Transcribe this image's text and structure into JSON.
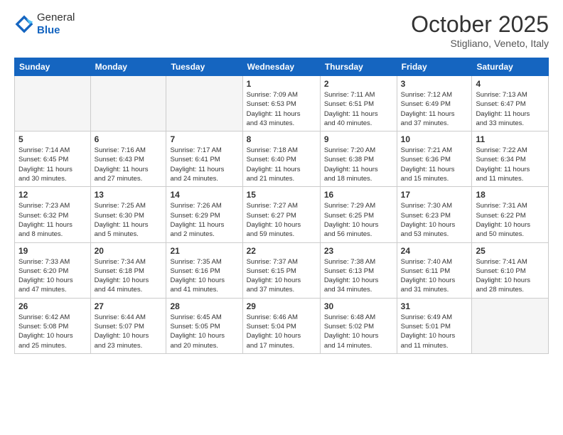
{
  "header": {
    "logo_general": "General",
    "logo_blue": "Blue",
    "month_title": "October 2025",
    "location": "Stigliano, Veneto, Italy"
  },
  "weekdays": [
    "Sunday",
    "Monday",
    "Tuesday",
    "Wednesday",
    "Thursday",
    "Friday",
    "Saturday"
  ],
  "weeks": [
    [
      {
        "day": "",
        "info": ""
      },
      {
        "day": "",
        "info": ""
      },
      {
        "day": "",
        "info": ""
      },
      {
        "day": "1",
        "info": "Sunrise: 7:09 AM\nSunset: 6:53 PM\nDaylight: 11 hours\nand 43 minutes."
      },
      {
        "day": "2",
        "info": "Sunrise: 7:11 AM\nSunset: 6:51 PM\nDaylight: 11 hours\nand 40 minutes."
      },
      {
        "day": "3",
        "info": "Sunrise: 7:12 AM\nSunset: 6:49 PM\nDaylight: 11 hours\nand 37 minutes."
      },
      {
        "day": "4",
        "info": "Sunrise: 7:13 AM\nSunset: 6:47 PM\nDaylight: 11 hours\nand 33 minutes."
      }
    ],
    [
      {
        "day": "5",
        "info": "Sunrise: 7:14 AM\nSunset: 6:45 PM\nDaylight: 11 hours\nand 30 minutes."
      },
      {
        "day": "6",
        "info": "Sunrise: 7:16 AM\nSunset: 6:43 PM\nDaylight: 11 hours\nand 27 minutes."
      },
      {
        "day": "7",
        "info": "Sunrise: 7:17 AM\nSunset: 6:41 PM\nDaylight: 11 hours\nand 24 minutes."
      },
      {
        "day": "8",
        "info": "Sunrise: 7:18 AM\nSunset: 6:40 PM\nDaylight: 11 hours\nand 21 minutes."
      },
      {
        "day": "9",
        "info": "Sunrise: 7:20 AM\nSunset: 6:38 PM\nDaylight: 11 hours\nand 18 minutes."
      },
      {
        "day": "10",
        "info": "Sunrise: 7:21 AM\nSunset: 6:36 PM\nDaylight: 11 hours\nand 15 minutes."
      },
      {
        "day": "11",
        "info": "Sunrise: 7:22 AM\nSunset: 6:34 PM\nDaylight: 11 hours\nand 11 minutes."
      }
    ],
    [
      {
        "day": "12",
        "info": "Sunrise: 7:23 AM\nSunset: 6:32 PM\nDaylight: 11 hours\nand 8 minutes."
      },
      {
        "day": "13",
        "info": "Sunrise: 7:25 AM\nSunset: 6:30 PM\nDaylight: 11 hours\nand 5 minutes."
      },
      {
        "day": "14",
        "info": "Sunrise: 7:26 AM\nSunset: 6:29 PM\nDaylight: 11 hours\nand 2 minutes."
      },
      {
        "day": "15",
        "info": "Sunrise: 7:27 AM\nSunset: 6:27 PM\nDaylight: 10 hours\nand 59 minutes."
      },
      {
        "day": "16",
        "info": "Sunrise: 7:29 AM\nSunset: 6:25 PM\nDaylight: 10 hours\nand 56 minutes."
      },
      {
        "day": "17",
        "info": "Sunrise: 7:30 AM\nSunset: 6:23 PM\nDaylight: 10 hours\nand 53 minutes."
      },
      {
        "day": "18",
        "info": "Sunrise: 7:31 AM\nSunset: 6:22 PM\nDaylight: 10 hours\nand 50 minutes."
      }
    ],
    [
      {
        "day": "19",
        "info": "Sunrise: 7:33 AM\nSunset: 6:20 PM\nDaylight: 10 hours\nand 47 minutes."
      },
      {
        "day": "20",
        "info": "Sunrise: 7:34 AM\nSunset: 6:18 PM\nDaylight: 10 hours\nand 44 minutes."
      },
      {
        "day": "21",
        "info": "Sunrise: 7:35 AM\nSunset: 6:16 PM\nDaylight: 10 hours\nand 41 minutes."
      },
      {
        "day": "22",
        "info": "Sunrise: 7:37 AM\nSunset: 6:15 PM\nDaylight: 10 hours\nand 37 minutes."
      },
      {
        "day": "23",
        "info": "Sunrise: 7:38 AM\nSunset: 6:13 PM\nDaylight: 10 hours\nand 34 minutes."
      },
      {
        "day": "24",
        "info": "Sunrise: 7:40 AM\nSunset: 6:11 PM\nDaylight: 10 hours\nand 31 minutes."
      },
      {
        "day": "25",
        "info": "Sunrise: 7:41 AM\nSunset: 6:10 PM\nDaylight: 10 hours\nand 28 minutes."
      }
    ],
    [
      {
        "day": "26",
        "info": "Sunrise: 6:42 AM\nSunset: 5:08 PM\nDaylight: 10 hours\nand 25 minutes."
      },
      {
        "day": "27",
        "info": "Sunrise: 6:44 AM\nSunset: 5:07 PM\nDaylight: 10 hours\nand 23 minutes."
      },
      {
        "day": "28",
        "info": "Sunrise: 6:45 AM\nSunset: 5:05 PM\nDaylight: 10 hours\nand 20 minutes."
      },
      {
        "day": "29",
        "info": "Sunrise: 6:46 AM\nSunset: 5:04 PM\nDaylight: 10 hours\nand 17 minutes."
      },
      {
        "day": "30",
        "info": "Sunrise: 6:48 AM\nSunset: 5:02 PM\nDaylight: 10 hours\nand 14 minutes."
      },
      {
        "day": "31",
        "info": "Sunrise: 6:49 AM\nSunset: 5:01 PM\nDaylight: 10 hours\nand 11 minutes."
      },
      {
        "day": "",
        "info": ""
      }
    ]
  ]
}
